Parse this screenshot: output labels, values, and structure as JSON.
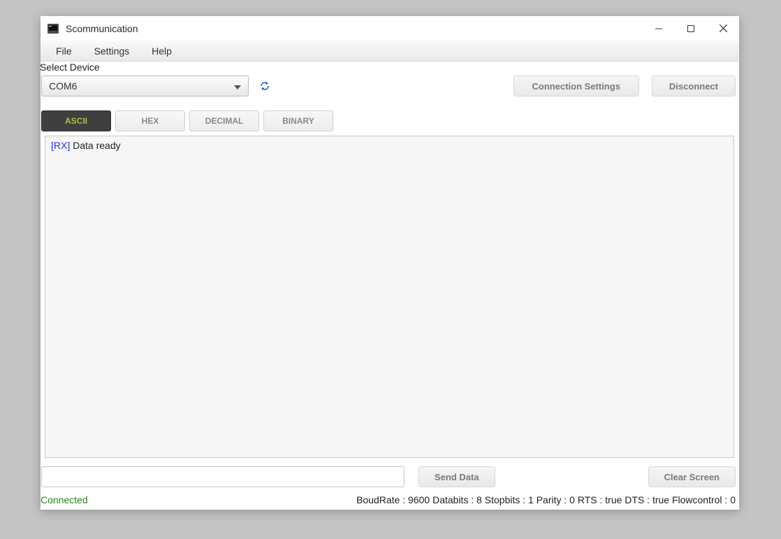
{
  "window": {
    "title": "Scommunication"
  },
  "menu": {
    "file": "File",
    "settings": "Settings",
    "help": "Help"
  },
  "device": {
    "label": "Select Device",
    "combo_value": "COM6",
    "connection_settings_btn": "Connection Settings",
    "disconnect_btn": "Disconnect"
  },
  "tabs": {
    "ascii": "ASCII",
    "hex": "HEX",
    "decimal": "DECIMAL",
    "binary": "BINARY"
  },
  "terminal": {
    "rx_tag": "[RX]",
    "rx_msg": "Data ready"
  },
  "tx": {
    "input_value": "",
    "send_btn": "Send Data",
    "clear_btn": "Clear Screen"
  },
  "status": {
    "connected": "Connected",
    "info": "BoudRate : 9600 Databits : 8 Stopbits : 1 Parity : 0 RTS : true DTS : true Flowcontrol : 0"
  }
}
